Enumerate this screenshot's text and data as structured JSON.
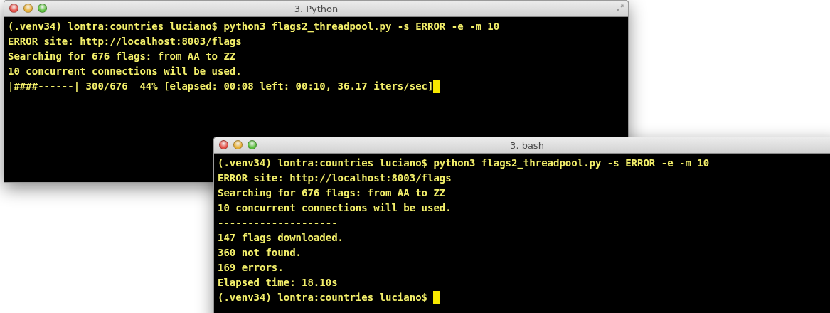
{
  "windows": [
    {
      "title": "3. Python",
      "lines": [
        "(.venv34) lontra:countries luciano$ python3 flags2_threadpool.py -s ERROR -e -m 10",
        "ERROR site: http://localhost:8003/flags",
        "Searching for 676 flags: from AA to ZZ",
        "10 concurrent connections will be used.",
        "|####------| 300/676  44% [elapsed: 00:08 left: 00:10, 36.17 iters/sec]"
      ]
    },
    {
      "title": "3. bash",
      "lines": [
        "(.venv34) lontra:countries luciano$ python3 flags2_threadpool.py -s ERROR -e -m 10",
        "ERROR site: http://localhost:8003/flags",
        "Searching for 676 flags: from AA to ZZ",
        "10 concurrent connections will be used.",
        "--------------------",
        "147 flags downloaded.",
        "360 not found.",
        "169 errors.",
        "Elapsed time: 18.10s",
        "(.venv34) lontra:countries luciano$ "
      ]
    }
  ]
}
